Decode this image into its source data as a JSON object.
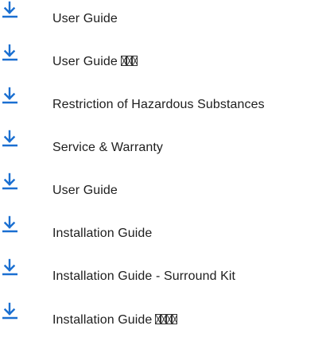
{
  "downloads": {
    "items": [
      {
        "label": "User Guide",
        "icon": "download-icon",
        "glyph_suffix": ""
      },
      {
        "label": "User Guide",
        "icon": "download-icon",
        "glyph_suffix": "□□□"
      },
      {
        "label": "Restriction of Hazardous Substances",
        "icon": "download-icon",
        "glyph_suffix": ""
      },
      {
        "label": "Service & Warranty",
        "icon": "download-icon",
        "glyph_suffix": ""
      },
      {
        "label": "User Guide",
        "icon": "download-icon",
        "glyph_suffix": ""
      },
      {
        "label": "Installation Guide",
        "icon": "download-icon",
        "glyph_suffix": ""
      },
      {
        "label": "Installation Guide - Surround Kit",
        "icon": "download-icon",
        "glyph_suffix": ""
      },
      {
        "label": "Installation Guide",
        "icon": "download-icon",
        "glyph_suffix": "□□□□"
      }
    ]
  },
  "colors": {
    "icon": "#1a6fd1",
    "text": "#1e1e1e",
    "background": "#ffffff"
  }
}
